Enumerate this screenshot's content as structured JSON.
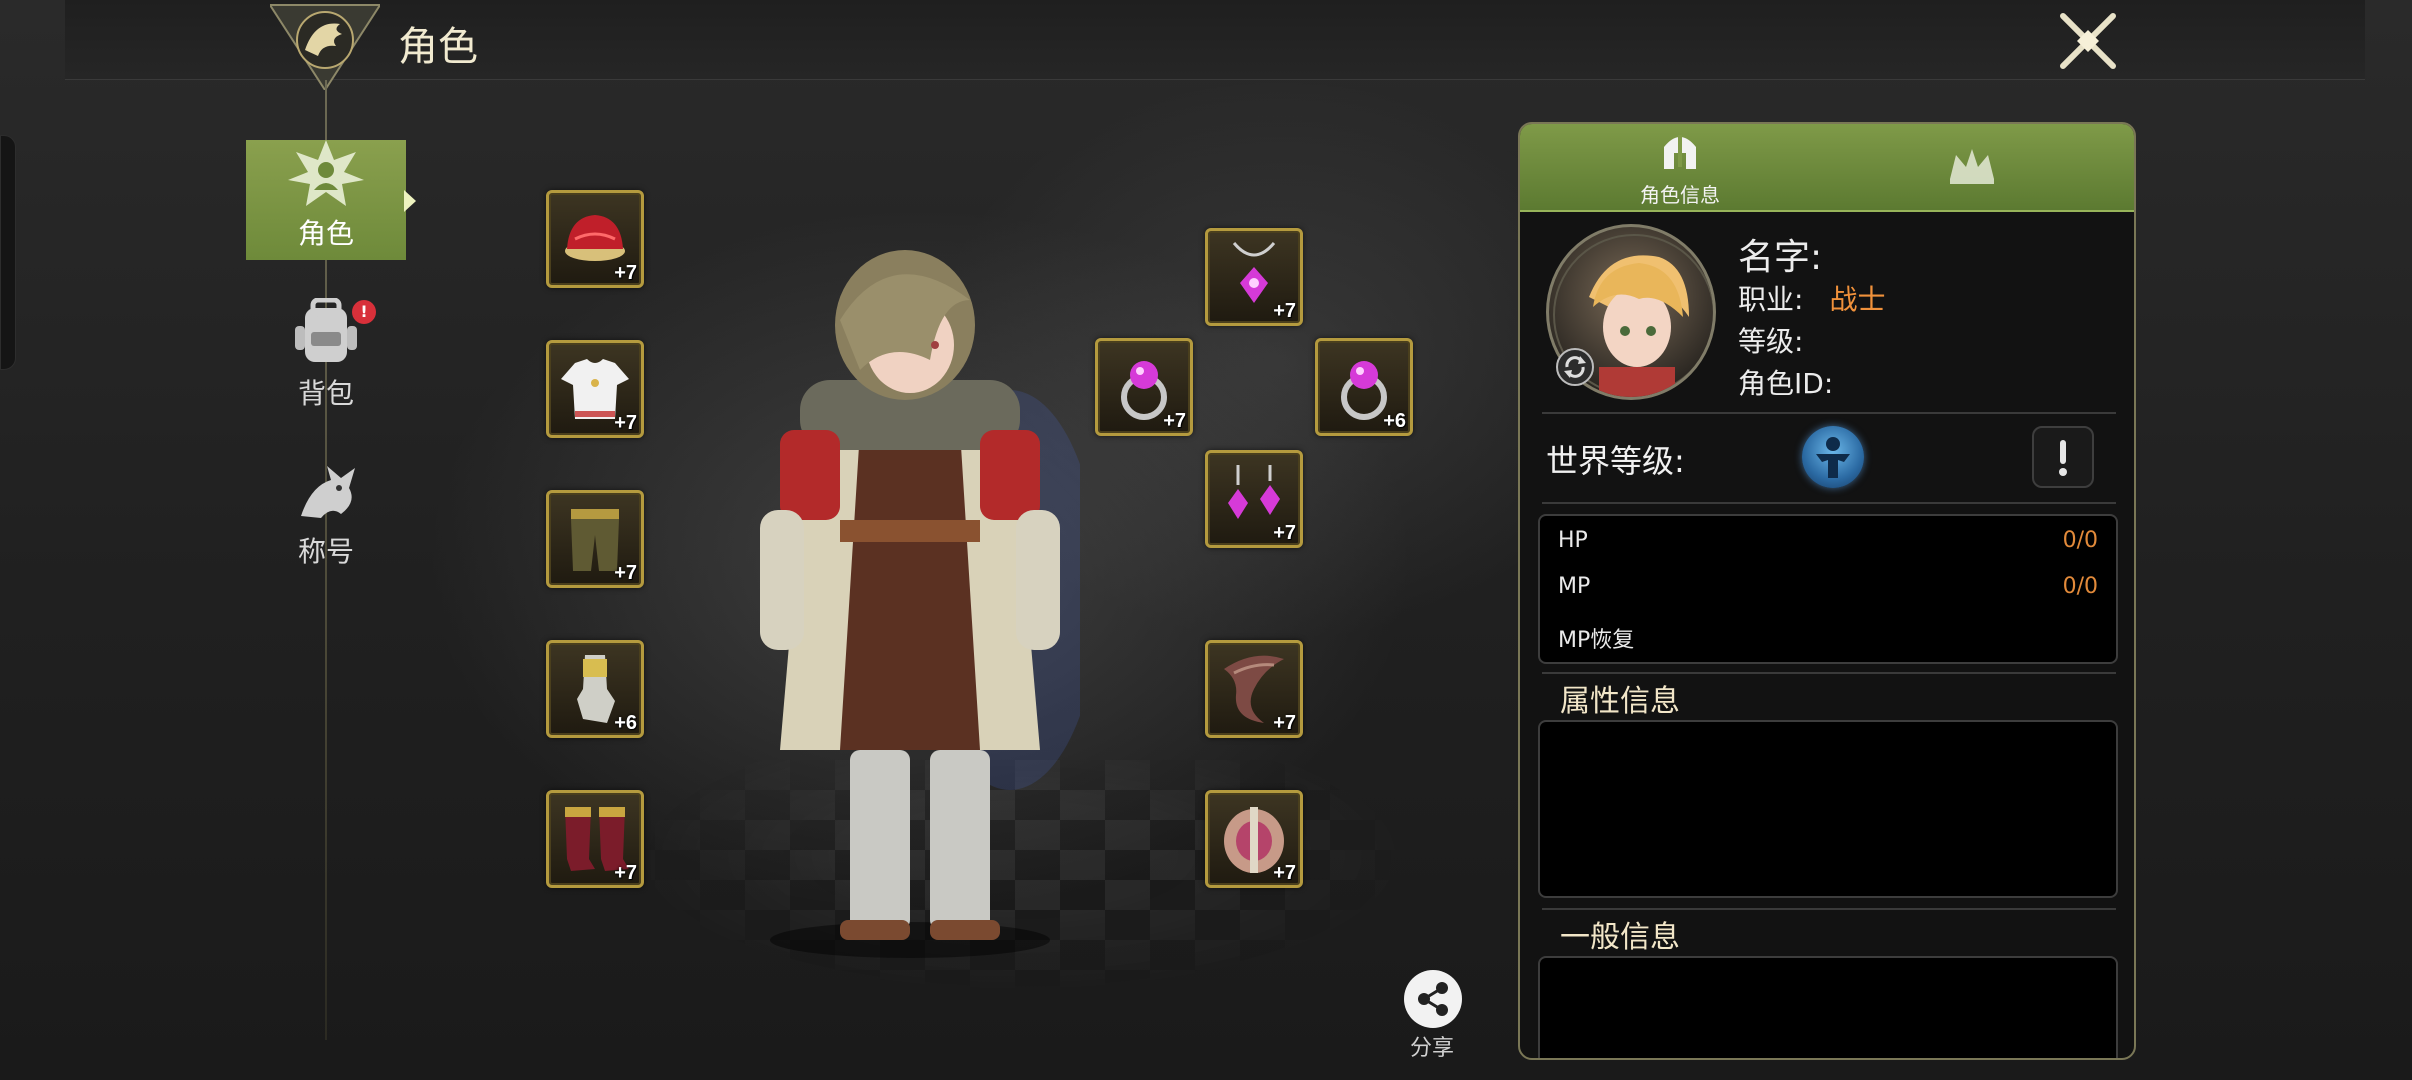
{
  "header": {
    "title": "角色"
  },
  "nav": {
    "items": [
      {
        "label": "角色",
        "active": true
      },
      {
        "label": "背包",
        "badge": "!"
      },
      {
        "label": "称号"
      }
    ]
  },
  "equipment": {
    "left": [
      {
        "name": "hat",
        "level": "+7"
      },
      {
        "name": "shirt",
        "level": "+7"
      },
      {
        "name": "pants",
        "level": "+7"
      },
      {
        "name": "gloves",
        "level": "+6"
      },
      {
        "name": "boots",
        "level": "+7"
      }
    ],
    "right": [
      {
        "name": "necklace",
        "level": "+7"
      },
      {
        "name": "ring-left",
        "level": "+7"
      },
      {
        "name": "ring-right",
        "level": "+6"
      },
      {
        "name": "earrings",
        "level": "+7"
      },
      {
        "name": "main-weapon",
        "level": "+7"
      },
      {
        "name": "sub-weapon",
        "level": "+7"
      }
    ]
  },
  "share": {
    "label": "分享"
  },
  "panel": {
    "tabs": [
      {
        "label": "角色信息",
        "active": true
      },
      {
        "label": ""
      }
    ],
    "name_label": "名字:",
    "job_label": "职业:",
    "job_value": "战士",
    "level_label": "等级:",
    "id_label": "角色ID:",
    "world_level_label": "世界等级:",
    "stats": [
      {
        "label": "HP",
        "value": "0/0"
      },
      {
        "label": "MP",
        "value": "0/0"
      },
      {
        "label": "MP恢复",
        "value": ""
      }
    ],
    "attr_title": "属性信息",
    "general_title": "一般信息"
  },
  "colors": {
    "accent_green": "#7f9a48",
    "gold": "#b49a3e",
    "job_orange": "#f0913b",
    "badge_red": "#d8303a"
  },
  "icons": [
    "dragon-emblem-icon",
    "close-swords-icon",
    "character-nav-icon",
    "backpack-icon",
    "dragon-title-icon",
    "share-icon",
    "helmet-icon",
    "crown-icon",
    "refresh-icon",
    "world-level-icon",
    "help-icon"
  ]
}
